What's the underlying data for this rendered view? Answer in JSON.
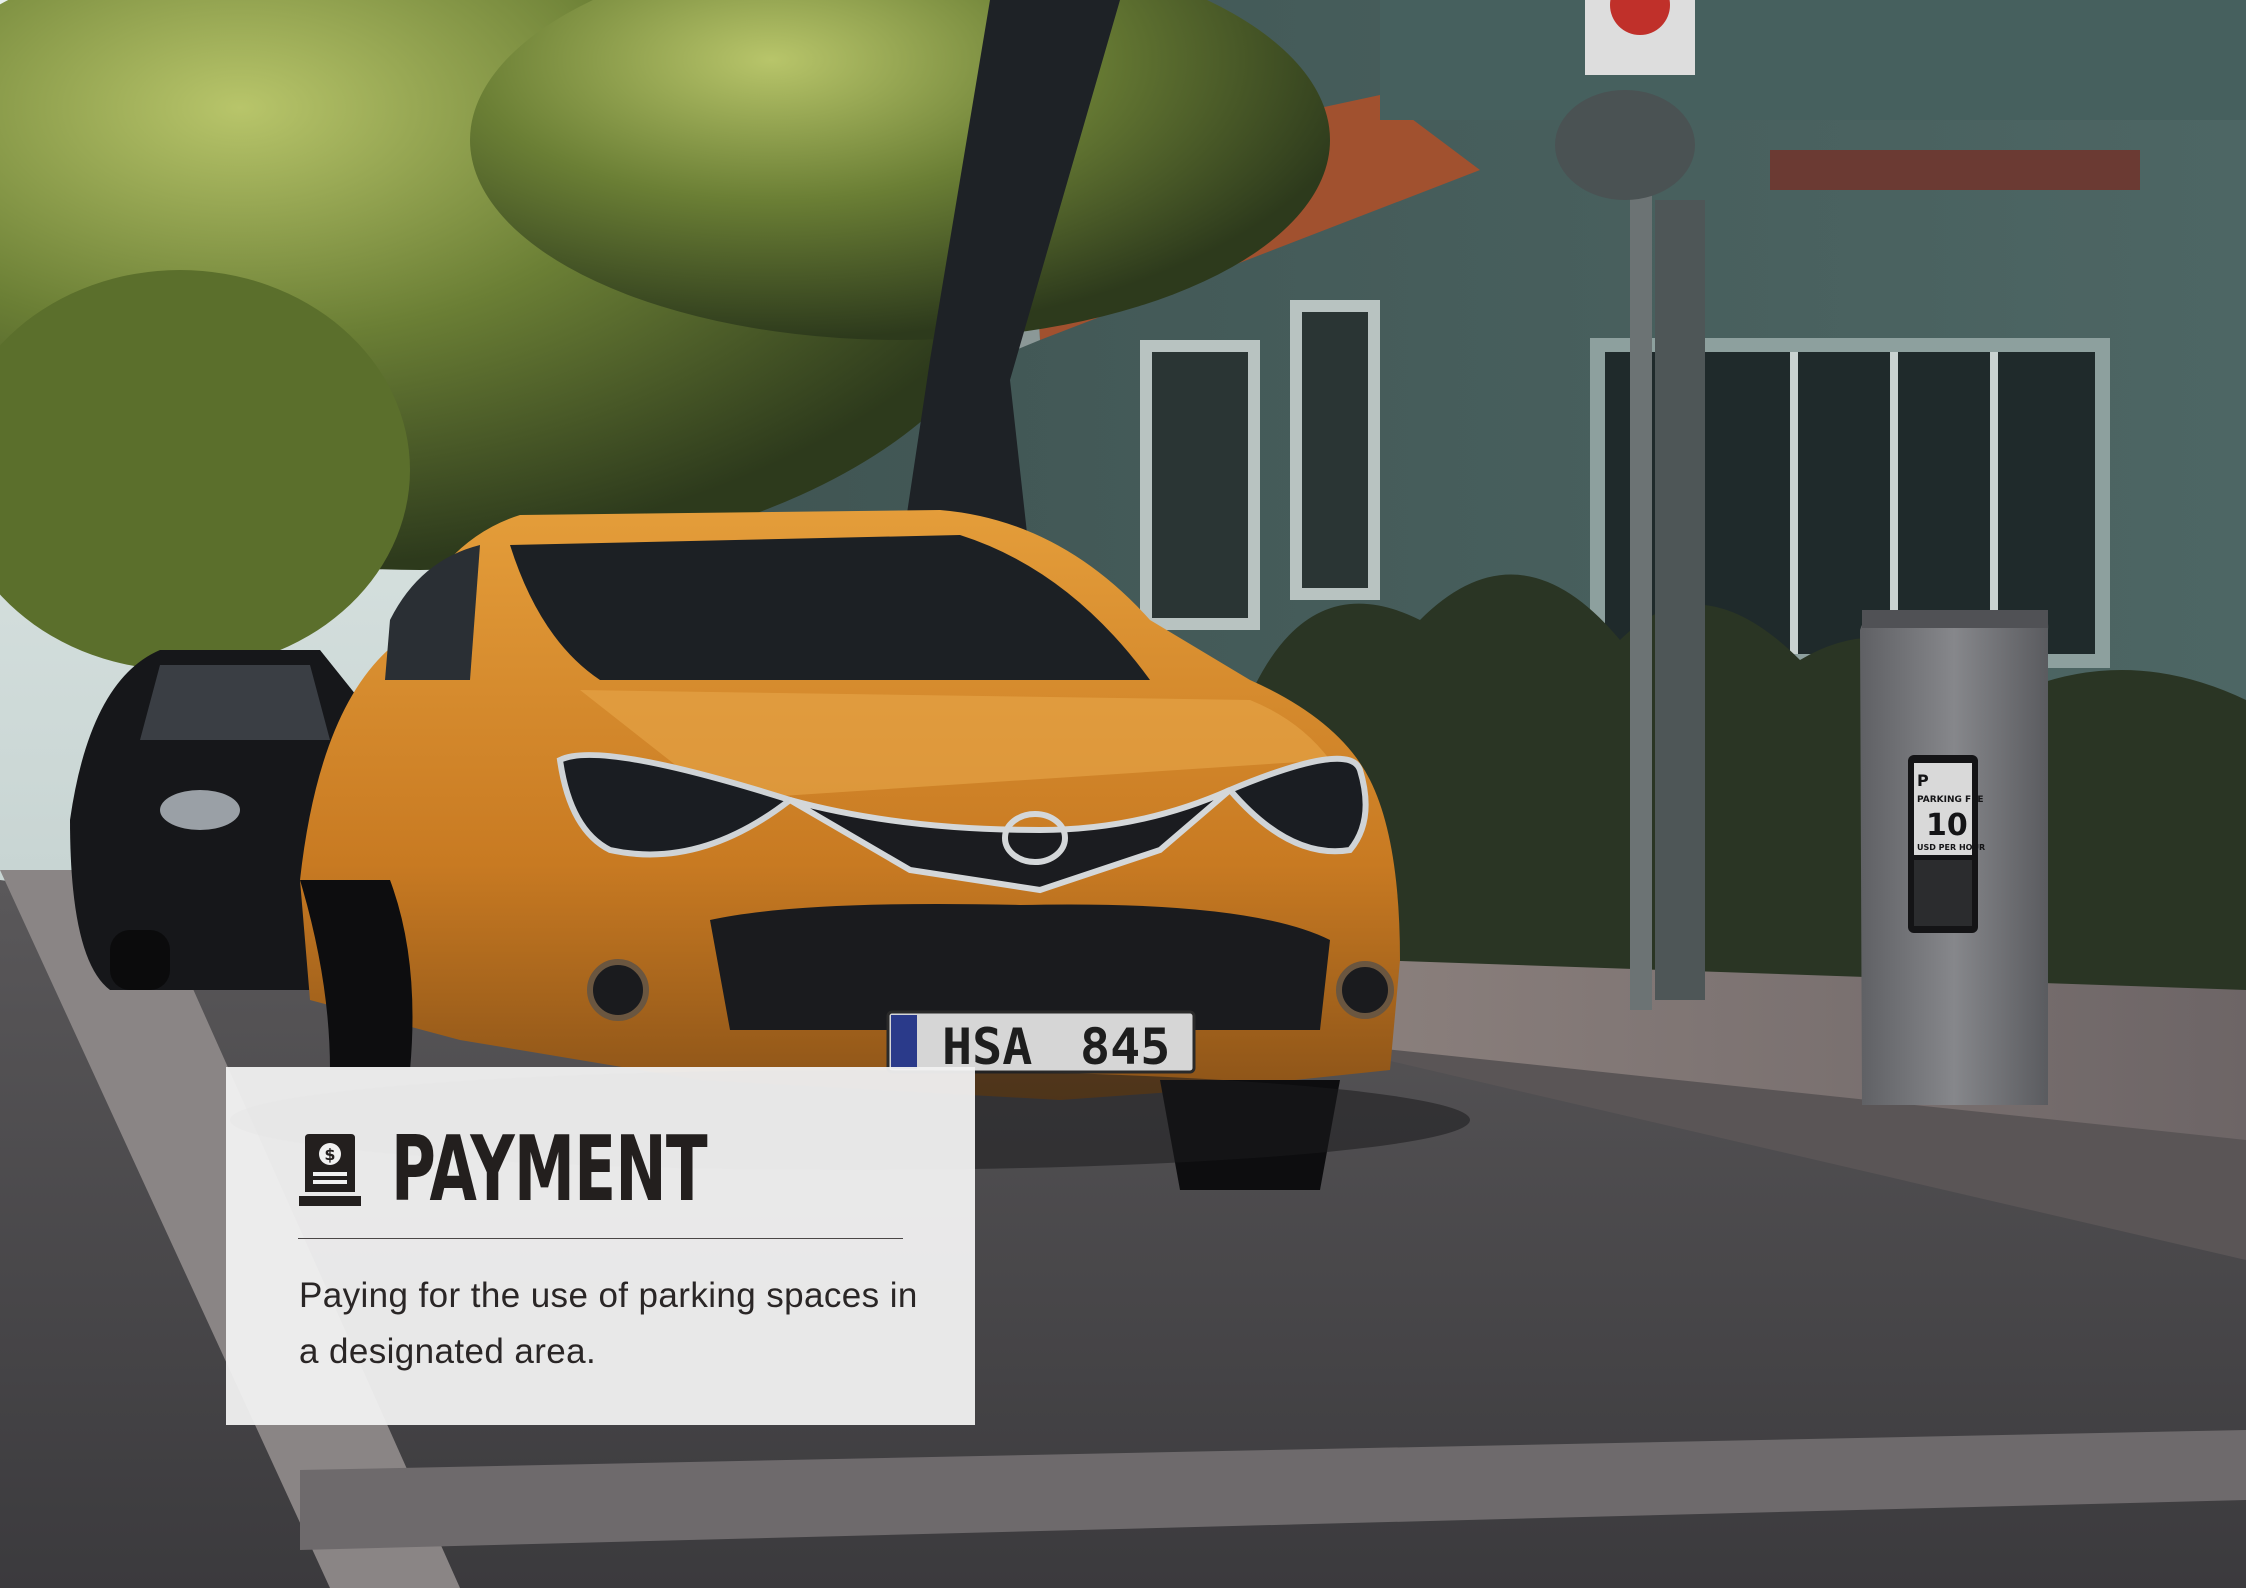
{
  "scene": {
    "description_alt": "",
    "license_plate": {
      "left": "HSA",
      "right": "845"
    },
    "parking_meter": {
      "header_glyph": "P",
      "line1": "PARKING FEE",
      "fee": "10",
      "line2": "USD PER HOUR"
    },
    "colors": {
      "car_orange": "#d98a2a",
      "building_teal": "#4f6c6a",
      "foliage": "#4f6a2a",
      "road": "#4b4b4d",
      "meter_body": "#7a7b7e"
    }
  },
  "card": {
    "icon": "parking-meter-dollar-icon",
    "title": "PAYMENT",
    "description": "Paying for the use of parking spaces in a designated area."
  }
}
